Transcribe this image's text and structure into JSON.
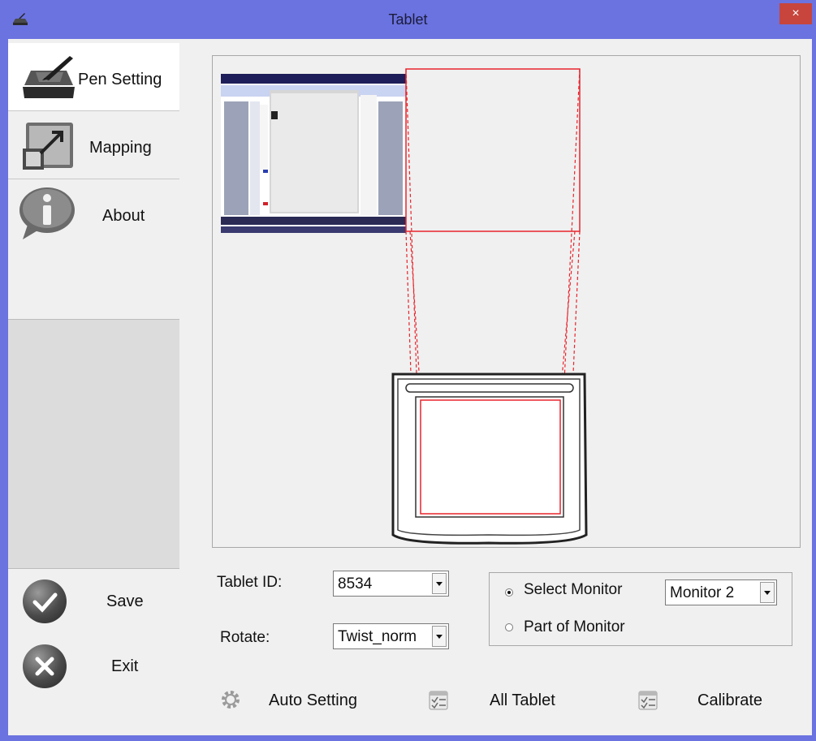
{
  "window": {
    "title": "Tablet",
    "close_glyph": "×"
  },
  "sidebar": {
    "items": [
      {
        "label": "Pen Setting",
        "icon": "pen-tablet-icon"
      },
      {
        "label": "Mapping",
        "icon": "mapping-arrow-icon"
      },
      {
        "label": "About",
        "icon": "info-bubble-icon"
      }
    ],
    "save_label": "Save",
    "exit_label": "Exit"
  },
  "settings": {
    "tablet_id_label": "Tablet ID:",
    "tablet_id_value": "8534",
    "rotate_label": "Rotate:",
    "rotate_value": "Twist_norm",
    "select_monitor_label": "Select Monitor",
    "part_of_monitor_label": "Part of Monitor",
    "monitor_value": "Monitor 2"
  },
  "buttons": {
    "auto_setting": "Auto Setting",
    "all_tablet": "All Tablet",
    "calibrate": "Calibrate"
  },
  "colors": {
    "titlebar": "#6b73e0",
    "close": "#c7453c",
    "mapping_line": "#e8242c"
  }
}
